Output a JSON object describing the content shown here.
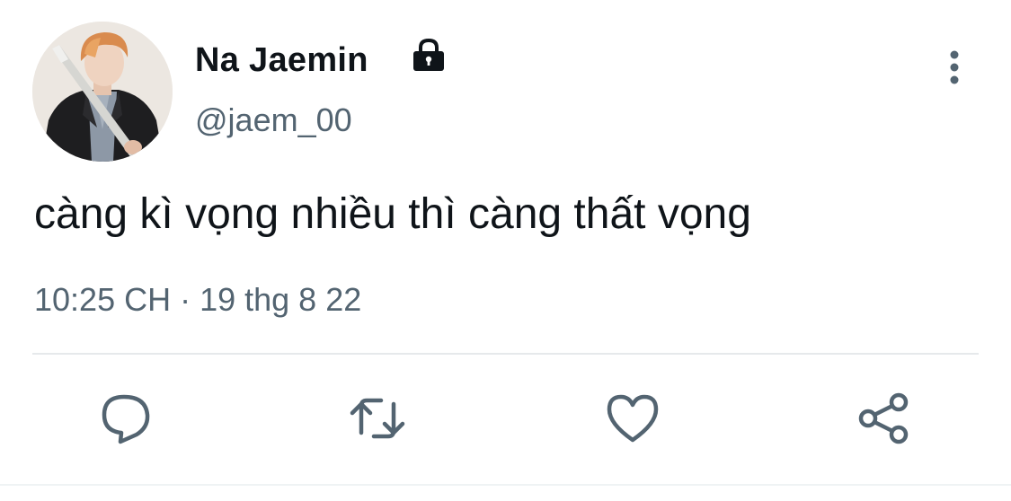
{
  "user": {
    "display_name": "Na Jaemin",
    "handle": "@jaem_00",
    "protected": true
  },
  "tweet": {
    "text": "càng kì vọng nhiều thì càng thất vọng",
    "meta": "10:25 CH · 19 thg 8 22"
  },
  "icons": {
    "lock": "lock-icon",
    "more": "more-vertical-icon",
    "reply": "reply-icon",
    "retweet": "retweet-icon",
    "like": "heart-icon",
    "share": "share-icon"
  },
  "colors": {
    "text_primary": "#0f1419",
    "text_secondary": "#536471",
    "icon": "#536471",
    "divider": "#e6e9eb"
  }
}
